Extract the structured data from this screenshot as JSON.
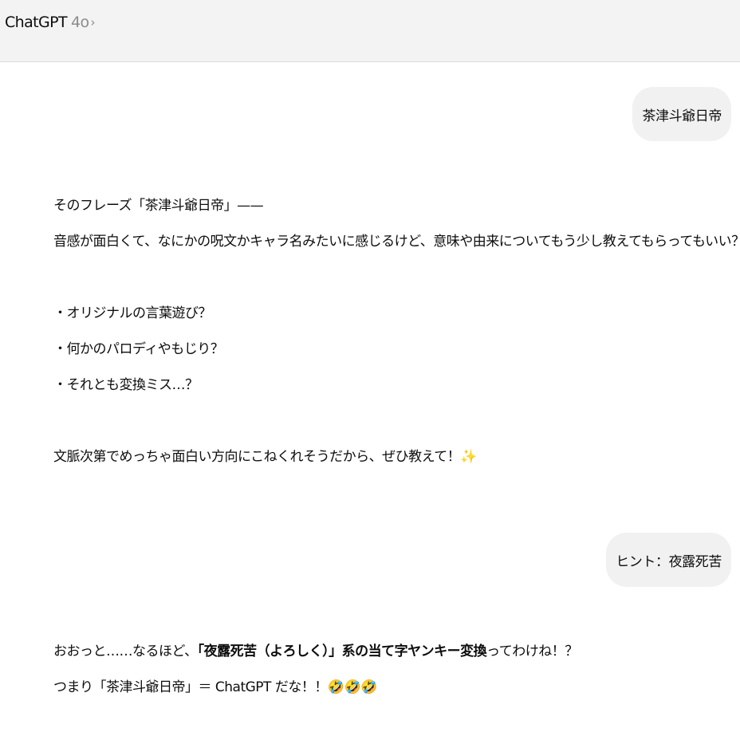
{
  "header": {
    "app_name": "ChatGPT",
    "model_version": "4o",
    "chevron": "›",
    "chevron_icon": "chevron-right-icon"
  },
  "conversation": {
    "user_message_1": "茶津斗爺日帝",
    "assistant_message_1": {
      "line1": "そのフレーズ「茶津斗爺日帝」——",
      "line2": "音感が面白くて、なにかの呪文かキャラ名みたいに感じるけど、意味や由来についてもう少し教えてもらってもいい？",
      "bullet1": "・オリジナルの言葉遊び？",
      "bullet2": "・何かのパロディやもじり？",
      "bullet3": "・それとも変換ミス…？",
      "closing": "文脈次第でめっちゃ面白い方向にこねくれそうだから、ぜひ教えて！",
      "closing_emoji": "✨"
    },
    "user_message_2": "ヒント：夜露死苦",
    "assistant_message_2": {
      "line1_prefix": "おおっと……なるほど、",
      "line1_bold": "「夜露死苦（よろしく）」系の当て字ヤンキー変換",
      "line1_suffix": "ってわけね！？",
      "line2": "つまり「茶津斗爺日帝」＝ ChatGPT だな！！",
      "line2_emoji": "🤣🤣🤣"
    }
  }
}
